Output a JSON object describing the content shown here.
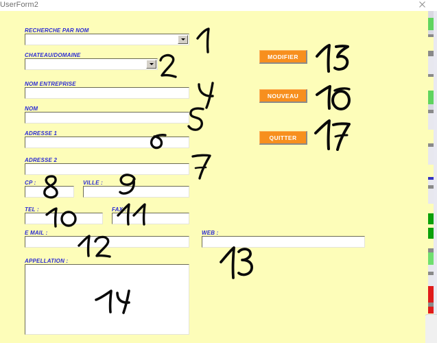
{
  "window": {
    "title": "UserForm2",
    "close_icon": "close-icon",
    "background_color": "#fdfdb9",
    "label_color": "#2b2bd4",
    "button_color": "#f78f1e"
  },
  "form": {
    "fields": [
      {
        "label": "RECHERCHE PAR NOM",
        "type": "combobox",
        "value": "",
        "annotation": "1"
      },
      {
        "label": "CHATEAU/DOMAINE",
        "type": "combobox",
        "value": "",
        "annotation": "2"
      },
      {
        "label": "NOM ENTREPRISE",
        "type": "textbox",
        "value": "",
        "annotation": "4"
      },
      {
        "label": "NOM",
        "type": "textbox",
        "value": "",
        "annotation": "5"
      },
      {
        "label": "ADRESSE 1",
        "type": "textbox",
        "value": "",
        "annotation": "6"
      },
      {
        "label": "ADRESSE 2",
        "type": "textbox",
        "value": "",
        "annotation": "7"
      },
      {
        "label": "CP :",
        "type": "textbox",
        "value": "",
        "annotation": "8"
      },
      {
        "label": "VILLE :",
        "type": "textbox",
        "value": "",
        "annotation": "9"
      },
      {
        "label": "TEL :",
        "type": "textbox",
        "value": "",
        "annotation": "10"
      },
      {
        "label": "FAX :",
        "type": "textbox",
        "value": "",
        "annotation": "11"
      },
      {
        "label": "E MAIL :",
        "type": "textbox",
        "value": "",
        "annotation": "12"
      },
      {
        "label": "WEB :",
        "type": "textbox",
        "value": "",
        "annotation": "13"
      },
      {
        "label": "APPELLATION :",
        "type": "listbox",
        "value": "",
        "annotation": "14"
      }
    ],
    "buttons": [
      {
        "label": "MODIFIER",
        "annotation": "15"
      },
      {
        "label": "NOUVEAU",
        "annotation": "16"
      },
      {
        "label": "QUITTER",
        "annotation": "17"
      }
    ]
  }
}
